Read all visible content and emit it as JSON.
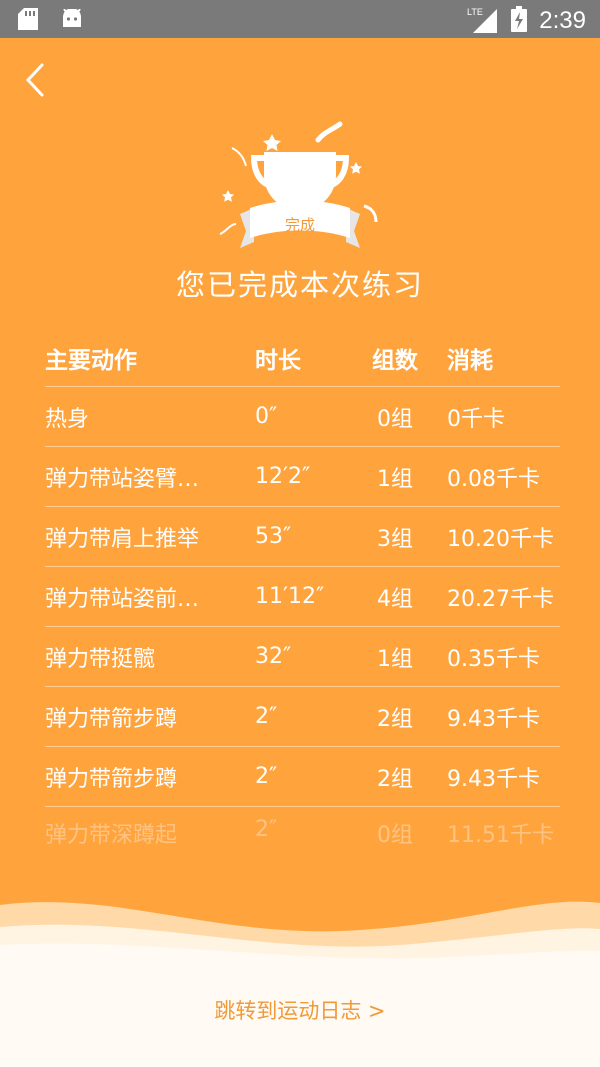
{
  "status": {
    "time": "2:39",
    "network": "LTE"
  },
  "header": {
    "title": "您已完成本次练习",
    "badge": "完成"
  },
  "table": {
    "headers": [
      "主要动作",
      "时长",
      "组数",
      "消耗"
    ],
    "rows": [
      [
        "热身",
        "0″",
        "0组",
        "0千卡"
      ],
      [
        "弹力带站姿臂…",
        "12′2″",
        "1组",
        "0.08千卡"
      ],
      [
        "弹力带肩上推举",
        "53″",
        "3组",
        "10.20千卡"
      ],
      [
        "弹力带站姿前…",
        "11′12″",
        "4组",
        "20.27千卡"
      ],
      [
        "弹力带挺髋",
        "32″",
        "1组",
        "0.35千卡"
      ],
      [
        "弹力带箭步蹲",
        "2″",
        "2组",
        "9.43千卡"
      ],
      [
        "弹力带箭步蹲",
        "2″",
        "2组",
        "9.43千卡"
      ],
      [
        "弹力带深蹲起",
        "2″",
        "0组",
        "11.51千卡"
      ]
    ]
  },
  "footer": {
    "link": "跳转到运动日志 >"
  },
  "colors": {
    "background": "#ffa33d",
    "link": "#f09a3a"
  }
}
